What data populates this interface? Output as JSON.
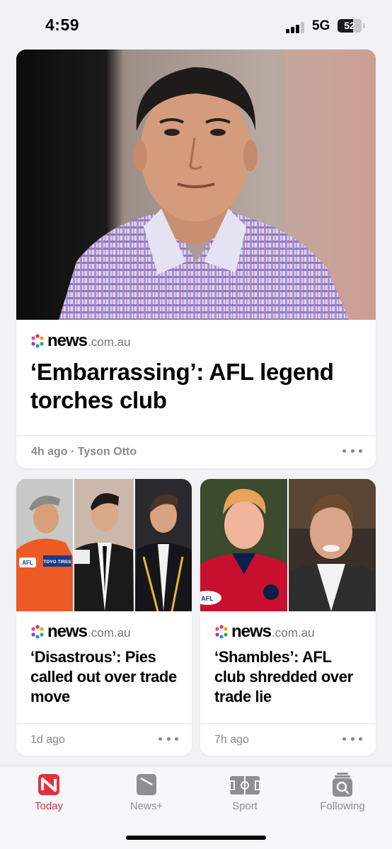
{
  "status_bar": {
    "time": "4:59",
    "network": "5G",
    "battery": "52"
  },
  "publisher": {
    "name": "news",
    "domain": ".com.au"
  },
  "hero": {
    "headline": "‘Embarrassing’: AFL legend torches club",
    "meta": "4h ago · Tyson Otto"
  },
  "cards": [
    {
      "headline": "‘Disastrous’: Pies called out over trade move",
      "meta": "1d ago"
    },
    {
      "headline": "‘Shambles’: AFL club shredded over trade lie",
      "meta": "7h ago"
    }
  ],
  "image_text": {
    "afl": "AFL",
    "toyo": "TOYO TIRES"
  },
  "tabs": [
    {
      "label": "Today",
      "icon": "news-icon",
      "active": true
    },
    {
      "label": "News+",
      "icon": "news-plus-icon",
      "active": false
    },
    {
      "label": "Sport",
      "icon": "sport-field-icon",
      "active": false
    },
    {
      "label": "Following",
      "icon": "following-search-icon",
      "active": false
    }
  ],
  "colors": {
    "accent": "#e4303e",
    "background": "#f2f2f5"
  }
}
